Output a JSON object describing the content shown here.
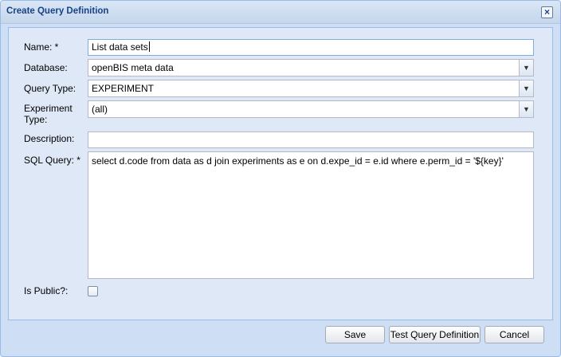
{
  "dialog": {
    "title": "Create Query Definition",
    "close_icon": "close-icon"
  },
  "form": {
    "name_label": "Name: *",
    "name_value": "List data sets",
    "database_label": "Database:",
    "database_value": "openBIS meta data",
    "query_type_label": "Query Type:",
    "query_type_value": "EXPERIMENT",
    "experiment_type_label_line1": "Experiment",
    "experiment_type_label_line2": "Type:",
    "experiment_type_value": "(all)",
    "description_label": "Description:",
    "description_value": "",
    "sql_label": "SQL Query: *",
    "sql_value": "select d.code from data as d join experiments as e on d.expe_id = e.id where e.perm_id = '${key}'",
    "is_public_label": "Is Public?:",
    "is_public_checked": false
  },
  "buttons": {
    "save": "Save",
    "test": "Test Query Definition",
    "cancel": "Cancel"
  },
  "colors": {
    "accent": "#15428b",
    "panel": "#dfe8f6",
    "border": "#99bbe8"
  }
}
